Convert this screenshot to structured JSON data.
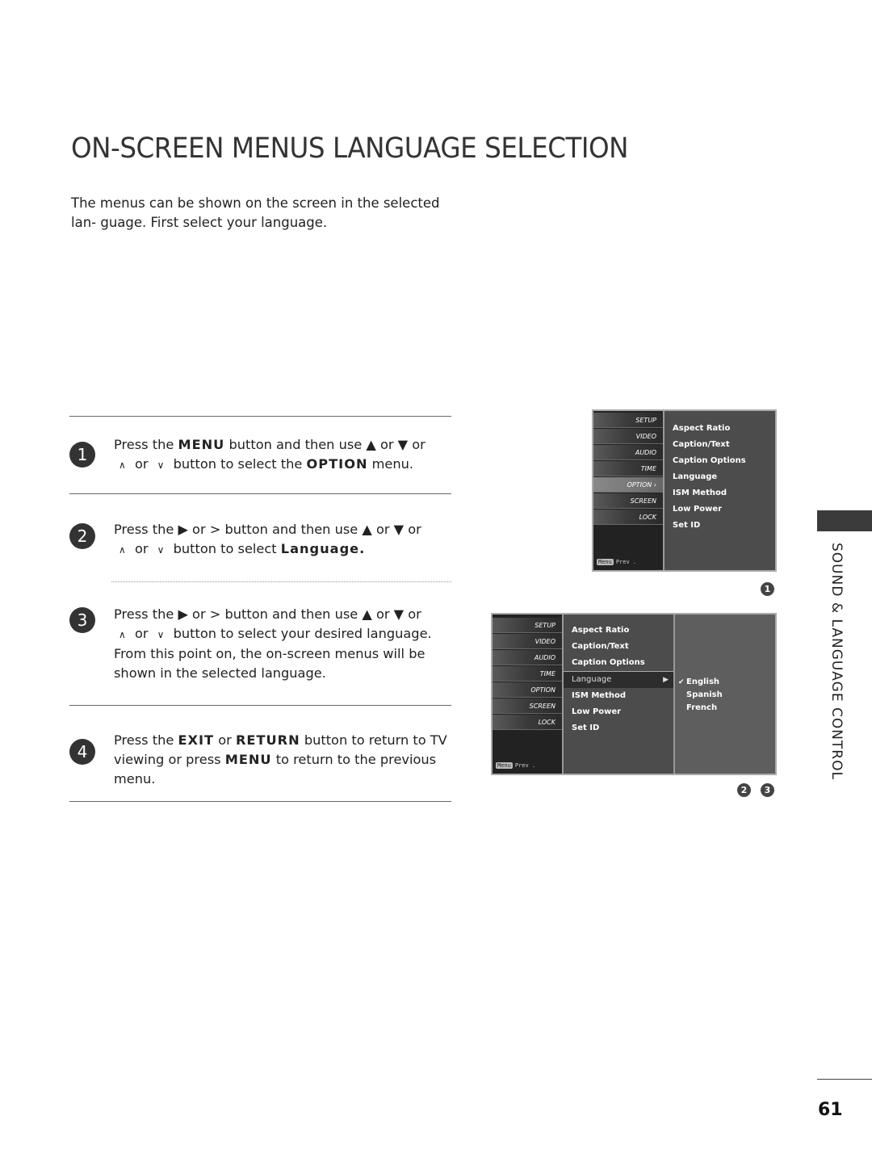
{
  "page": {
    "title": "ON-SCREEN MENUS LANGUAGE SELECTION",
    "intro": "The menus can be shown on the screen in the selected lan- guage. First select your language.",
    "section_label": "SOUND & LANGUAGE CONTROL",
    "page_number": "61"
  },
  "steps": [
    {
      "number": "1",
      "parts": {
        "a": "Press the ",
        "b1": "MENU",
        "c": " button and then use ▲ or ▼  or",
        "d": "∧",
        "e": " or ",
        "f": "∨",
        "g": " button to select the ",
        "b2": "OPTION",
        "h": " menu."
      }
    },
    {
      "number": "2",
      "parts": {
        "a": "Press the ▶  or  >  button and then use ▲ or ▼  or",
        "d": "∧",
        "e": " or ",
        "f": "∨",
        "g": " button to select ",
        "b1": "Language."
      }
    },
    {
      "number": "3",
      "parts": {
        "a": "Press the ▶  or  >  button and then use ▲ or ▼  or",
        "d": "∧",
        "e": " or ",
        "f": "∨",
        "g": " button to select your desired language.",
        "h": "From this point on, the on-screen menus will be shown in the selected language."
      }
    },
    {
      "number": "4",
      "parts": {
        "a": "Press the ",
        "b1": "EXIT",
        "c": " or ",
        "b2": "RETURN",
        "d": " button to return to TV viewing or press ",
        "b3": "MENU",
        "e": " to return to the previous menu."
      }
    }
  ],
  "osd1": {
    "side_items": [
      "SETUP",
      "VIDEO",
      "AUDIO",
      "TIME",
      "OPTION ›",
      "SCREEN",
      "LOCK"
    ],
    "active_side": "OPTION",
    "prev_tag": "Menu",
    "prev_label": "Prev .",
    "main_items": [
      "Aspect Ratio",
      "Caption/Text",
      "Caption Options",
      "Language",
      "ISM Method",
      "Low Power",
      "Set ID"
    ],
    "caption_steps": "1"
  },
  "osd2": {
    "side_items": [
      "SETUP",
      "VIDEO",
      "AUDIO",
      "TIME",
      "OPTION",
      "SCREEN",
      "LOCK"
    ],
    "prev_tag": "Menu",
    "prev_label": "Prev .",
    "main_items": [
      "Aspect Ratio",
      "Caption/Text",
      "Caption Options",
      "Language",
      "ISM Method",
      "Low Power",
      "Set ID"
    ],
    "highlighted": "Language",
    "arrow": "▶",
    "sub_items": [
      "English",
      "Spanish",
      "French"
    ],
    "selected_sub": "English",
    "check": "✔",
    "caption_steps": [
      "2",
      "3"
    ]
  }
}
